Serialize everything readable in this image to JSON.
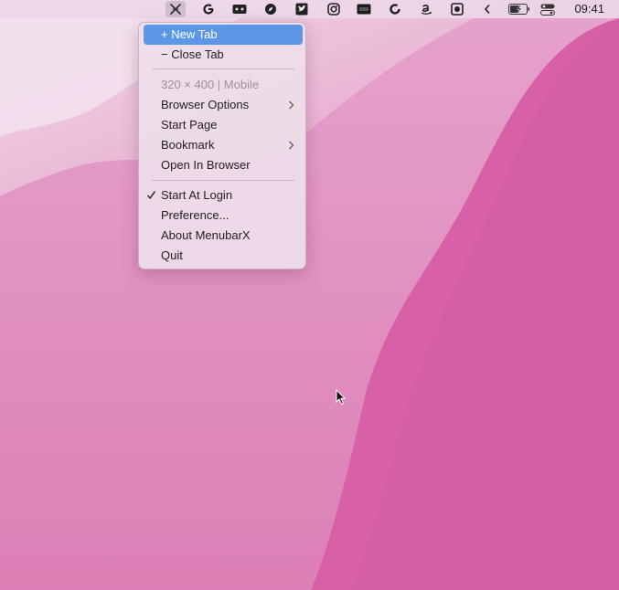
{
  "menubar": {
    "icons": [
      {
        "name": "menubarx-icon",
        "active": true
      },
      {
        "name": "google-icon"
      },
      {
        "name": "gamepad-icon"
      },
      {
        "name": "compass-icon"
      },
      {
        "name": "twitter-icon"
      },
      {
        "name": "instagram-icon"
      },
      {
        "name": "imdb-icon"
      },
      {
        "name": "refresh-icon"
      },
      {
        "name": "amazon-icon"
      },
      {
        "name": "settings-icon"
      },
      {
        "name": "chevron-left-icon"
      },
      {
        "name": "battery-icon"
      },
      {
        "name": "control-center-icon"
      }
    ],
    "clock": "09:41"
  },
  "menu": {
    "new_tab": "+ New Tab",
    "close_tab": "− Close Tab",
    "size_info": "320 × 400 | Mobile",
    "browser_options": "Browser Options",
    "start_page": "Start Page",
    "bookmark": "Bookmark",
    "open_in_browser": "Open In Browser",
    "start_at_login": "Start At Login",
    "start_at_login_checked": true,
    "preference": "Preference...",
    "about": "About MenubarX",
    "quit": "Quit"
  },
  "colors": {
    "highlight": "#5b97e6",
    "wallpaper_pink": "#d860a6",
    "wallpaper_light": "#f0c6df"
  }
}
